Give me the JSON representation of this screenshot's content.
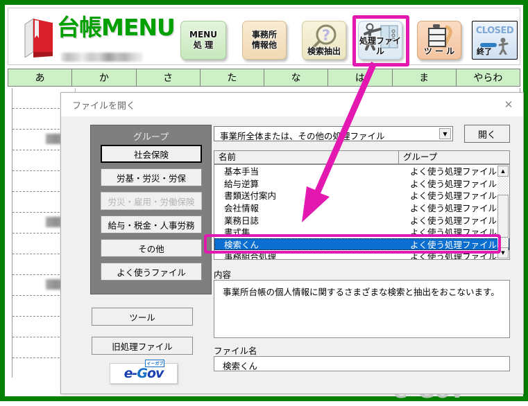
{
  "header": {
    "logo_text": "台帳MENU",
    "logo_icon": "red-book-icon",
    "buttons": [
      {
        "label1": "MENU",
        "label2": "処 理",
        "icon": "menu-icon"
      },
      {
        "label1": "事務所",
        "label2": "情報他",
        "icon": "office-icon"
      },
      {
        "label": "検索抽出",
        "icon": "magnifier-question-icon"
      },
      {
        "label": "処理ファイル",
        "icon": "person-book-icon"
      },
      {
        "label": "ツ ー ル",
        "icon": "tool-shelf-icon"
      },
      {
        "label": "終了",
        "label_top": "CLOSED",
        "icon": "exit-person-icon"
      }
    ]
  },
  "kana_tabs": [
    "あ",
    "か",
    "さ",
    "た",
    "な",
    "は",
    "ま",
    "やらわ"
  ],
  "watermark": "e-Gov",
  "dialog": {
    "title": "ファイルを開く",
    "close_icon": "close-icon",
    "group_panel": {
      "heading": "グループ",
      "buttons": [
        {
          "label": "社会保険",
          "state": "selected"
        },
        {
          "label": "労基・労災・労保",
          "state": "normal"
        },
        {
          "label": "労災・雇用・労働保険",
          "state": "disabled"
        },
        {
          "label": "給与・税金・人事労務",
          "state": "normal"
        },
        {
          "label": "その他",
          "state": "normal"
        },
        {
          "label": "よく使うファイル",
          "state": "normal"
        }
      ]
    },
    "other_buttons": [
      {
        "label": "ツール"
      },
      {
        "label": "旧処理ファイル"
      }
    ],
    "egov": {
      "text": "e-Gov",
      "ruby": "イーガブ"
    },
    "combo": {
      "value": "事業所全体または、その他の処理ファイル",
      "arrow_icon": "chevron-down-icon"
    },
    "open_button": "開く",
    "list_headers": {
      "name": "名前",
      "group": "グループ"
    },
    "list_rows": [
      {
        "name": "基本手当",
        "group": "よく使う処理ファイル",
        "selected": false
      },
      {
        "name": "給与逆算",
        "group": "よく使う処理ファイル",
        "selected": false
      },
      {
        "name": "書類送付案内",
        "group": "よく使う処理ファイル",
        "selected": false
      },
      {
        "name": "会社情報",
        "group": "よく使う処理ファイル",
        "selected": false
      },
      {
        "name": "業務日誌",
        "group": "よく使う処理ファイル",
        "selected": false
      },
      {
        "name": "書式集",
        "group": "よく使う処理ファイル",
        "selected": false
      },
      {
        "name": "検索くん",
        "group": "よく使う処理ファイル",
        "selected": true
      },
      {
        "name": "事務組合処理",
        "group": "よく使う処理ファイル",
        "selected": false
      }
    ],
    "scroll": {
      "up_icon": "scroll-up-icon",
      "down_icon": "scroll-down-icon"
    },
    "content_label": "内容",
    "content_text": "事業所台帳の個人情報に関するさまざまな検索と抽出をおこないます。",
    "filename_label": "ファイル名",
    "filename_value": "検索くん"
  },
  "annotations": {
    "highlight_color": "#e318b0",
    "arrow": "magenta-arrow-from-shori-file-button-to-kensakukun-row"
  },
  "colors": {
    "window_border_green": "#008000",
    "logo_green": "#00a000",
    "kana_tab_green": "#cdf0c7",
    "selection_blue": "#0a6fd0",
    "magenta": "#e318b0"
  }
}
